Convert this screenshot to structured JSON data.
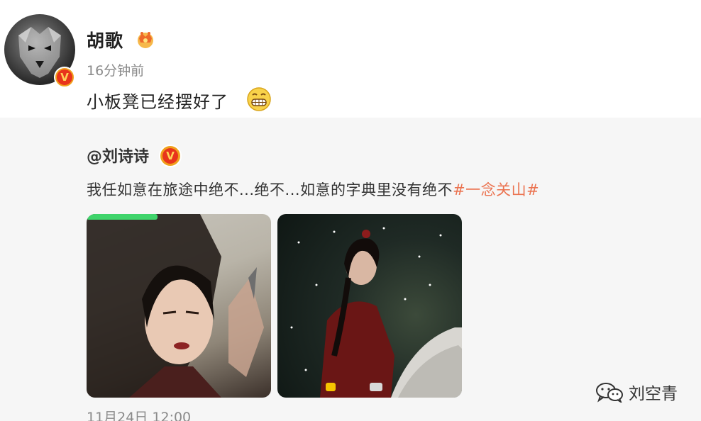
{
  "post": {
    "username": "胡歌",
    "timestamp": "16分钟前",
    "text": "小板凳已经摆好了",
    "footer_time": "11月24日 12:00"
  },
  "repost": {
    "author": "@刘诗诗",
    "text": "我任如意在旅途中绝不...绝不...如意的字典里没有绝不",
    "hashtag": "#一念关山#"
  },
  "watermark": {
    "text": "刘空青"
  },
  "icons": {
    "verified": "verified-v-icon",
    "crown": "crown-icon",
    "grin": "grin-emoji-icon",
    "wechat": "wechat-icon"
  },
  "colors": {
    "hashtag": "#eb7350",
    "badge_red": "#e8341c",
    "badge_gold": "#f0a01c",
    "repost_bg": "#f6f6f6"
  }
}
